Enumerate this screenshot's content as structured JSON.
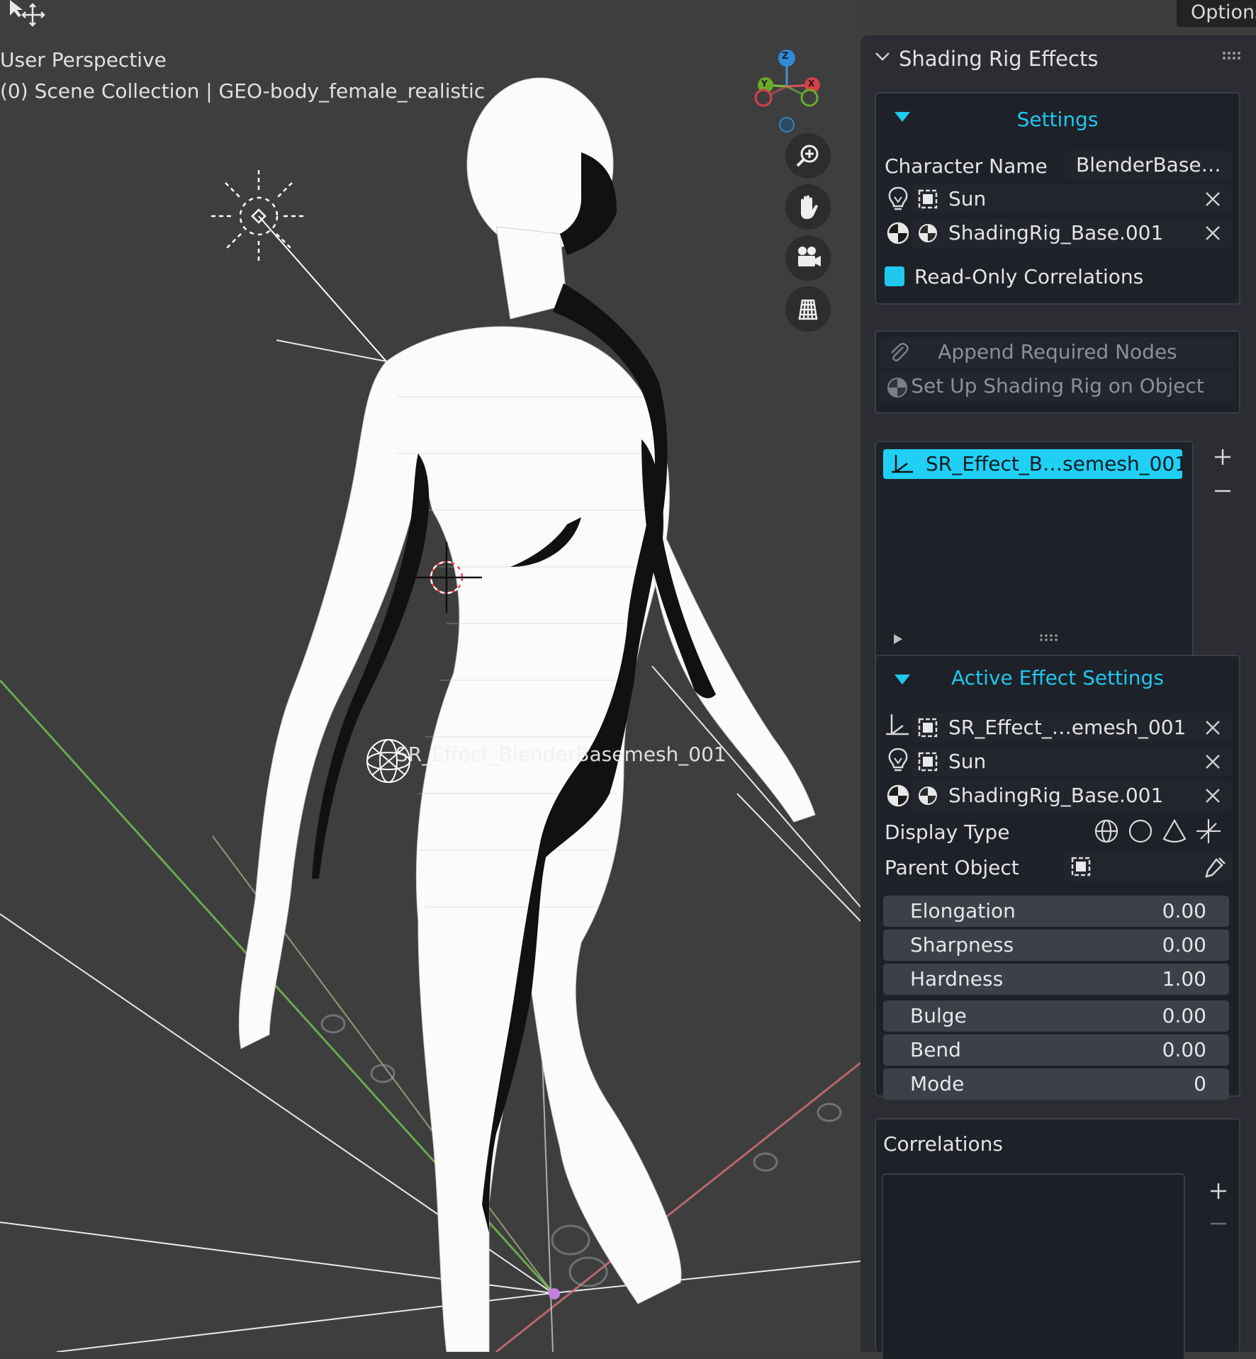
{
  "viewport": {
    "view_name": "User Perspective",
    "collection_path": "(0) Scene Collection | GEO-body_female_realistic",
    "empty_label": "SR_Effect_BlenderBasemesh_001",
    "options_label": "Options",
    "gizmo_axes": [
      "Z",
      "Y",
      "X"
    ]
  },
  "panel": {
    "title": "Shading Rig Effects",
    "settings": {
      "title": "Settings",
      "character_name_label": "Character Name",
      "character_name_value": "BlenderBase…",
      "light_object": "Sun",
      "base_object": "ShadingRig_Base.001",
      "readonly_label": "Read-Only Correlations",
      "readonly_checked": true
    },
    "actions": {
      "append_label": "Append Required Nodes",
      "setup_label": "Set Up Shading Rig on Object"
    },
    "effects_list": {
      "items": [
        "SR_Effect_B…semesh_001"
      ]
    },
    "active_effect": {
      "title": "Active Effect Settings",
      "effect_object": "SR_Effect_…emesh_001",
      "light_object": "Sun",
      "base_object": "ShadingRig_Base.001",
      "display_type_label": "Display Type",
      "parent_object_label": "Parent Object",
      "properties": [
        {
          "label": "Elongation",
          "value": "0.00"
        },
        {
          "label": "Sharpness",
          "value": "0.00"
        },
        {
          "label": "Hardness",
          "value": "1.00"
        },
        {
          "label": "Bulge",
          "value": "0.00"
        },
        {
          "label": "Bend",
          "value": "0.00"
        },
        {
          "label": "Mode",
          "value": "0"
        }
      ]
    },
    "correlations": {
      "title": "Correlations"
    }
  },
  "colors": {
    "accent": "#1fc8ee",
    "panel_bg": "#2b2d33",
    "viewport_bg": "#3e3e3e"
  }
}
